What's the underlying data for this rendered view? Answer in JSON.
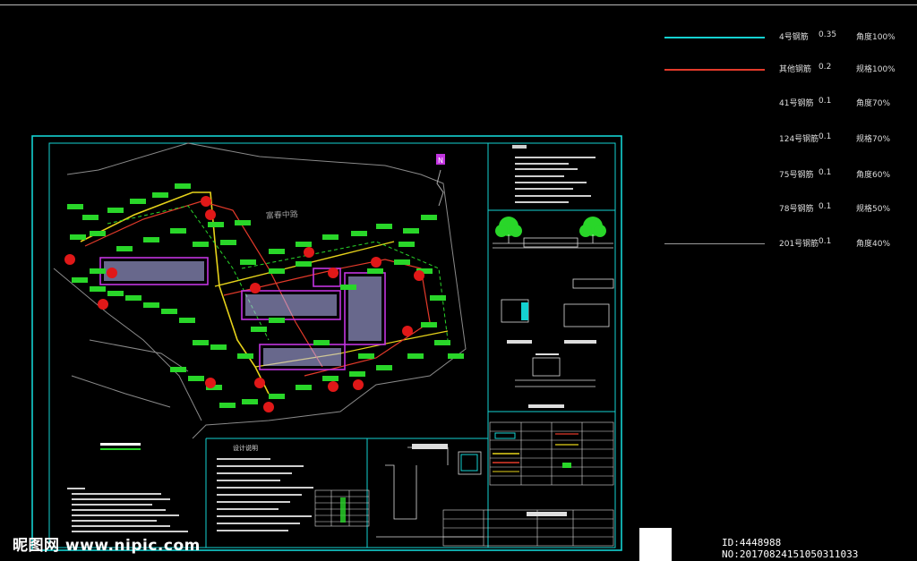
{
  "legend": [
    {
      "label": "4号钢筋",
      "value": "0.35",
      "note": "角度100%",
      "color": "#14d2d2"
    },
    {
      "label": "其他钢筋",
      "value": "0.2",
      "note": "规格100%",
      "color": "#e33a2a"
    },
    {
      "label": "41号钢筋",
      "value": "0.1",
      "note": "角度70%",
      "color": ""
    },
    {
      "label": "124号钢筋",
      "value": "0.1",
      "note": "规格70%",
      "color": ""
    },
    {
      "label": "75号钢筋",
      "value": "0.1",
      "note": "角度60%",
      "color": ""
    },
    {
      "label": "78号钢筋",
      "value": "0.1",
      "note": "规格50%",
      "color": ""
    },
    {
      "label": "201号钢筋",
      "value": "0.1",
      "note": "角度40%",
      "color": "#9a9a9a"
    }
  ],
  "drawing": {
    "road_label": "富春中路",
    "north_marker": "N",
    "notes_title": "设计说明",
    "frame_color": "#14d2d2",
    "tree_color": "#29d629",
    "hydrant_color": "#e01818",
    "building_color": "#c234e0"
  },
  "watermark": {
    "site": "昵图网 www.nipic.com",
    "image_id": "ID:4448988 NO:20170824151050311033"
  }
}
